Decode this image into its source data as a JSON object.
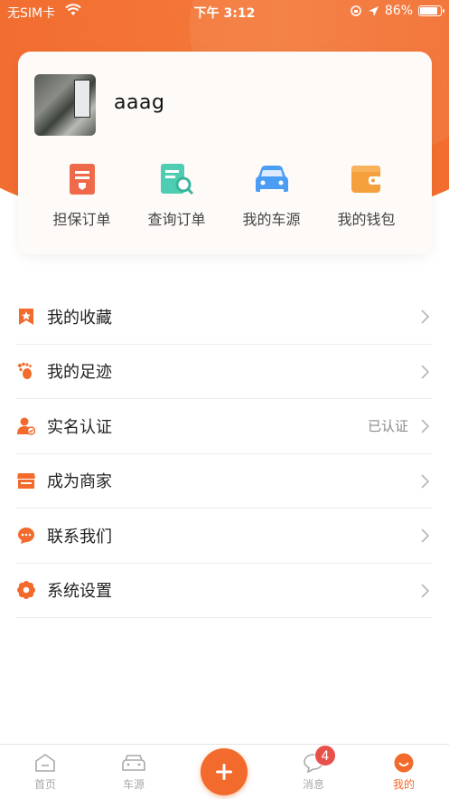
{
  "status_bar": {
    "carrier": "无SIM卡",
    "time": "下午 3:12",
    "battery": "86%"
  },
  "profile": {
    "username": "aaag"
  },
  "quick_actions": [
    {
      "label": "担保订单",
      "icon": "guarantee-order-icon",
      "color": "#ef6a4a"
    },
    {
      "label": "查询订单",
      "icon": "search-order-icon",
      "color": "#4ecdb3"
    },
    {
      "label": "我的车源",
      "icon": "car-icon",
      "color": "#4b9cf4"
    },
    {
      "label": "我的钱包",
      "icon": "wallet-icon",
      "color": "#f5a03c"
    }
  ],
  "menu": [
    {
      "label": "我的收藏",
      "value": "",
      "icon": "bookmark-star-icon"
    },
    {
      "label": "我的足迹",
      "value": "",
      "icon": "footprint-icon"
    },
    {
      "label": "实名认证",
      "value": "已认证",
      "icon": "verified-user-icon"
    },
    {
      "label": "成为商家",
      "value": "",
      "icon": "store-icon"
    },
    {
      "label": "联系我们",
      "value": "",
      "icon": "chat-icon"
    },
    {
      "label": "系统设置",
      "value": "",
      "icon": "settings-icon"
    }
  ],
  "tabbar": {
    "items": [
      {
        "label": "首页",
        "icon": "home-icon",
        "active": false
      },
      {
        "label": "车源",
        "icon": "car-outline-icon",
        "active": false
      },
      {
        "label": "消息",
        "icon": "message-icon",
        "active": false,
        "badge": "4"
      },
      {
        "label": "我的",
        "icon": "smile-icon",
        "active": true
      }
    ],
    "center_icon": "plus-icon"
  },
  "colors": {
    "accent": "#f26a2c",
    "badge": "#e8504a"
  }
}
